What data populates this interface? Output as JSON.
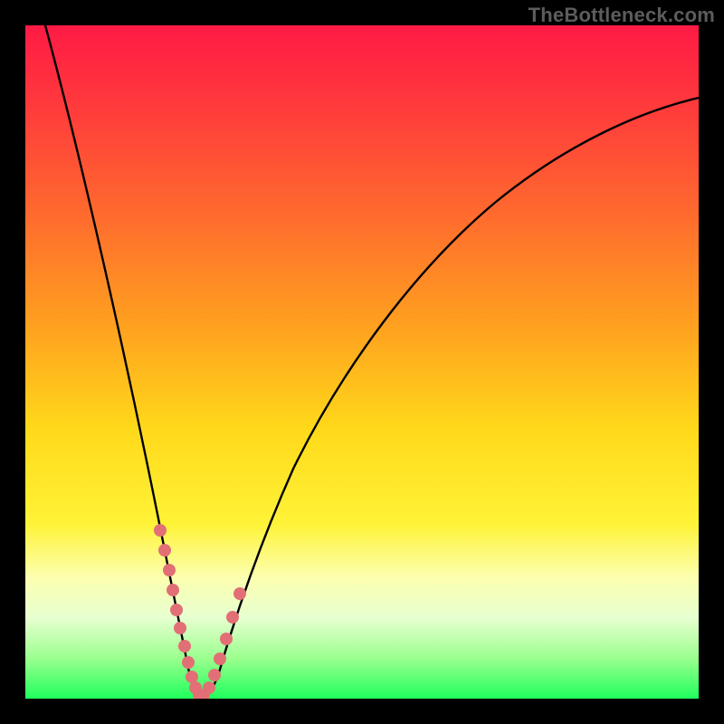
{
  "watermark": "TheBottleneck.com",
  "colors": {
    "frame": "#000000",
    "curve_stroke": "#000000",
    "marker_fill": "#e26f76",
    "gradient_stops": [
      "#ff1a44",
      "#ff3a3c",
      "#ff6a2e",
      "#ffa21f",
      "#ffd91a",
      "#fff337",
      "#fcffb0",
      "#e7ffd0",
      "#9bff8e",
      "#1fff5d"
    ]
  },
  "chart_data": {
    "type": "line",
    "title": "",
    "xlabel": "",
    "ylabel": "",
    "xlim": [
      0,
      100
    ],
    "ylim": [
      0,
      100
    ],
    "note": "Axes are unlabeled in the image; curve is a V-shaped dip reaching ~0 near x≈25, rising steeply on both sides. Values below are estimated from the pixel positions.",
    "x": [
      3,
      5,
      8,
      11,
      14,
      17,
      19,
      21,
      23,
      24,
      25,
      26,
      27,
      28,
      30,
      33,
      37,
      42,
      48,
      55,
      62,
      70,
      78,
      86,
      94,
      100
    ],
    "y": [
      100,
      90,
      76,
      62,
      48,
      36,
      27,
      18,
      9,
      4,
      1,
      0,
      1,
      3,
      8,
      15,
      24,
      34,
      44,
      54,
      62,
      70,
      76,
      81,
      85,
      88
    ],
    "markers_x": [
      19.5,
      20.5,
      21.5,
      22.2,
      23.0,
      23.6,
      24.2,
      24.7,
      25.2,
      25.7,
      26.3,
      27.0,
      27.8,
      28.6,
      29.6,
      30.6,
      31.8
    ],
    "markers_y": [
      24,
      20,
      16,
      13,
      10,
      7.5,
      5,
      3,
      1.5,
      0.8,
      0.5,
      1.2,
      2.5,
      4.5,
      7,
      10,
      14
    ]
  }
}
